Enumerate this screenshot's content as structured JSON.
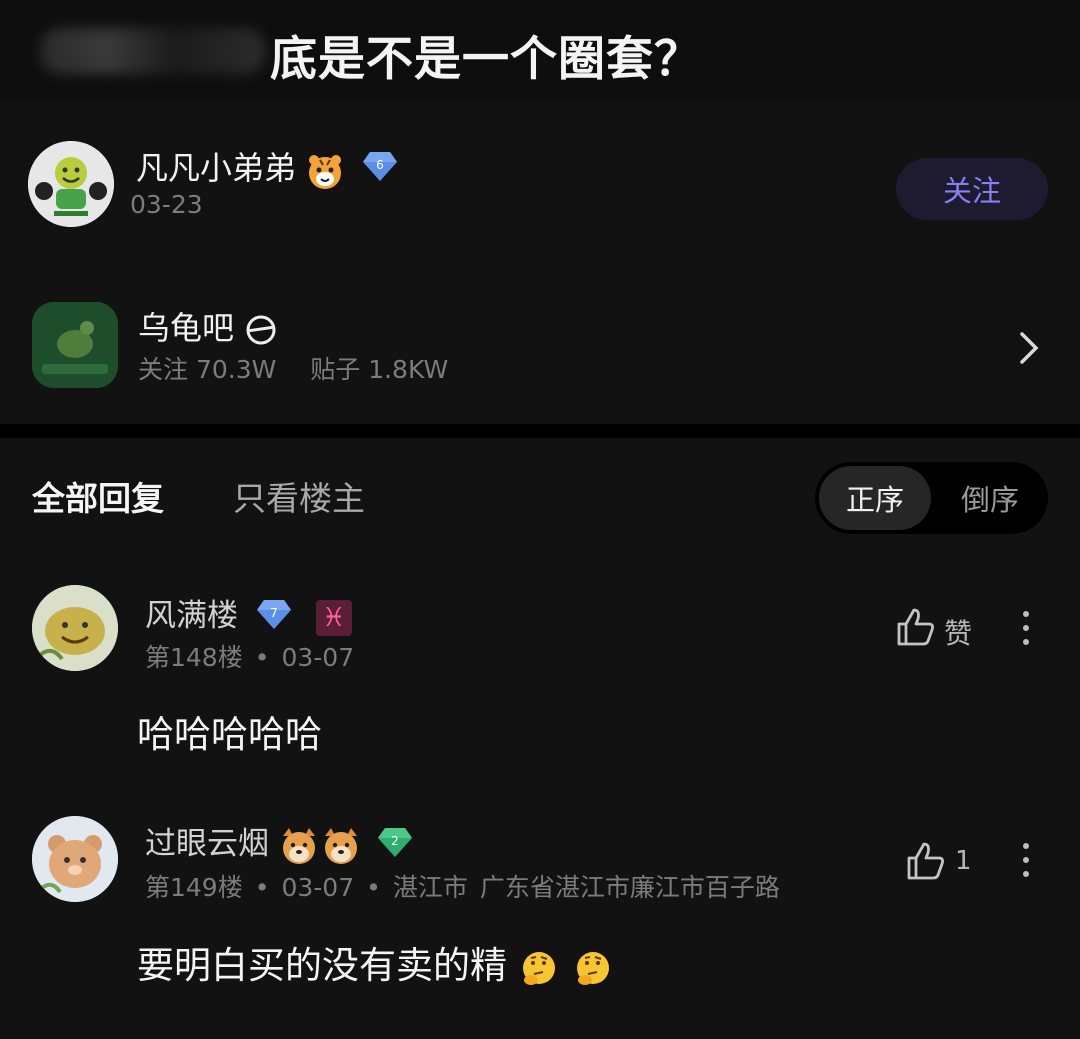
{
  "post": {
    "title": "底是不是一个圈套？",
    "author": {
      "name": "凡凡小弟弟",
      "level": "6",
      "date": "03-23",
      "follow_label": "关注"
    },
    "forum": {
      "name": "乌龟吧",
      "followers_label": "关注 70.3W",
      "posts_label": "贴子 1.8KW"
    }
  },
  "tabs": {
    "all": "全部回复",
    "op_only": "只看楼主"
  },
  "sort": {
    "asc": "正序",
    "desc": "倒序"
  },
  "replies": [
    {
      "name": "风满楼",
      "level": "7",
      "zodiac": "♓",
      "floor": "第148楼",
      "date": "03-07",
      "like_label": "赞",
      "content": "哈哈哈哈哈"
    },
    {
      "name": "过眼云烟",
      "level": "2",
      "floor": "第149楼",
      "date": "03-07",
      "location_city": "湛江市",
      "location_detail": "广东省湛江市廉江市百子路",
      "like_count": "1",
      "content": "要明白买的没有卖的精"
    }
  ],
  "colors": {
    "accent": "#8c7cf6",
    "background": "#121212",
    "gem": "#5b8ee6",
    "gem_green": "#2fae6f"
  }
}
